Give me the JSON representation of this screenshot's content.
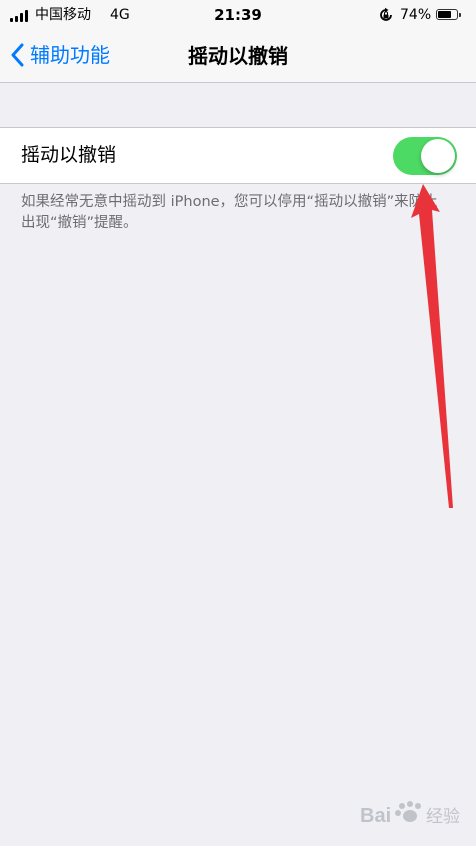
{
  "status_bar": {
    "carrier": "中国移动",
    "network": "4G",
    "time": "21:39",
    "battery_percent": "74%",
    "battery_level": 0.74,
    "rotation_lock_icon": "rotation-lock-icon"
  },
  "nav": {
    "back_label": "辅助功能",
    "title": "摇动以撤销",
    "back_icon": "chevron-left-icon"
  },
  "setting": {
    "label": "摇动以撤销",
    "enabled": true
  },
  "footer": {
    "text": "如果经常无意中摇动到 iPhone，您可以停用“摇动以撤销”来防止出现“撤销”提醒。"
  },
  "colors": {
    "accent": "#007aff",
    "toggle_on": "#4cd964",
    "annotation_arrow": "#e8333b",
    "background": "#efeff4"
  },
  "watermark": {
    "text": "Bai 经验"
  }
}
